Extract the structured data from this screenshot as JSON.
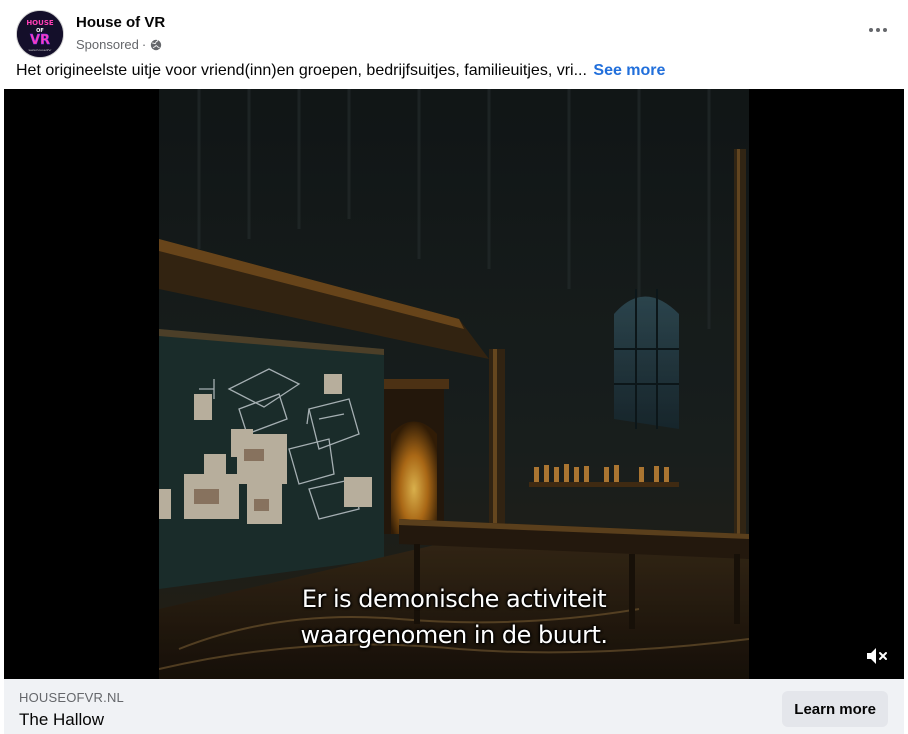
{
  "header": {
    "page_name": "House of VR",
    "sponsored_label": "Sponsored",
    "separator": "·",
    "avatar_text_top": "HOUSE",
    "avatar_text_mid": "OF",
    "avatar_text_bottom": "VR",
    "avatar_small_text": "www.houseofvr"
  },
  "caption": {
    "text": "Het origineelste uitje voor vriend(inn)en groepen, bedrijfsuitjes, familieuitjes, vri...",
    "see_more": "See more"
  },
  "video": {
    "subtitle_line_1": "Er is demonische activiteit",
    "subtitle_line_2": "waargenomen in de buurt.",
    "muted": true
  },
  "footer": {
    "domain": "HOUSEOFVR.NL",
    "title": "The Hallow",
    "cta_label": "Learn more"
  },
  "colors": {
    "link": "#216fdb",
    "secondary_text": "#65676b",
    "footer_bg": "#f0f2f5",
    "button_bg": "#e4e6eb"
  },
  "icons": {
    "globe": "globe-icon",
    "more": "more-horizontal-icon",
    "mute": "speaker-muted-icon"
  }
}
